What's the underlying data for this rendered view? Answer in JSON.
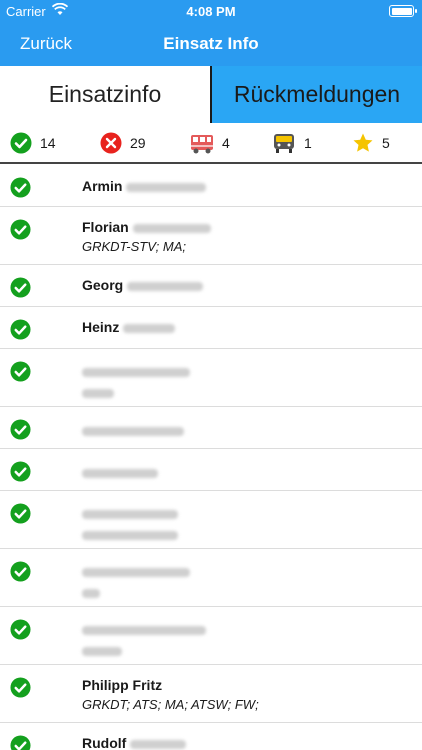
{
  "status_bar": {
    "carrier": "Carrier",
    "time": "4:08 PM"
  },
  "nav": {
    "back_label": "Zurück",
    "title": "Einsatz Info"
  },
  "segments": {
    "info_label": "Einsatzinfo",
    "responses_label": "Rückmeldungen"
  },
  "counts": [
    {
      "icon": "check-icon",
      "value": "14"
    },
    {
      "icon": "cross-icon",
      "value": "29"
    },
    {
      "icon": "fire-truck-icon",
      "value": "4"
    },
    {
      "icon": "vehicle-front-icon",
      "value": "1"
    },
    {
      "icon": "star-icon",
      "value": "5"
    }
  ],
  "people": [
    {
      "name": "Armin",
      "roles": ""
    },
    {
      "name": "Florian",
      "roles": "GRKDT-STV; MA;"
    },
    {
      "name": "Georg",
      "roles": ""
    },
    {
      "name": "Heinz",
      "roles": ""
    },
    {
      "name": "",
      "roles": ""
    },
    {
      "name": "",
      "roles": ""
    },
    {
      "name": "",
      "roles": ""
    },
    {
      "name": "",
      "roles": ""
    },
    {
      "name": "",
      "roles": ""
    },
    {
      "name": "",
      "roles": ""
    },
    {
      "name": "Philipp Fritz",
      "roles": "GRKDT; ATS; MA; ATSW; FW;"
    },
    {
      "name": "Rudolf",
      "roles": ""
    }
  ],
  "colors": {
    "accent": "#2a9bf0",
    "accept": "#14a01e",
    "decline": "#e8231e",
    "star": "#f5c400"
  }
}
